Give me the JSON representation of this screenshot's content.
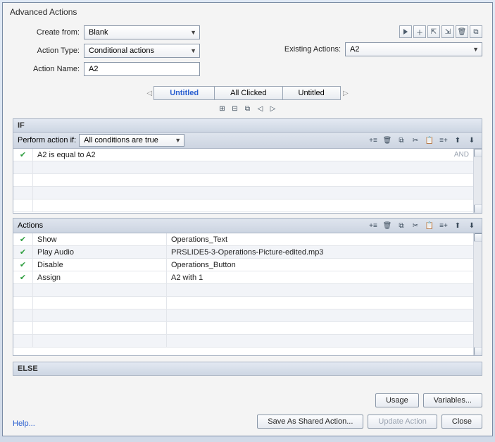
{
  "title": "Advanced Actions",
  "form": {
    "createFromLabel": "Create from:",
    "createFromValue": "Blank",
    "actionTypeLabel": "Action Type:",
    "actionTypeValue": "Conditional actions",
    "actionNameLabel": "Action Name:",
    "actionNameValue": "A2",
    "existingActionsLabel": "Existing Actions:",
    "existingActionsValue": "A2"
  },
  "tabs": [
    "Untitled",
    "All Clicked",
    "Untitled"
  ],
  "ifSection": {
    "header": "IF",
    "performLabel": "Perform action if:",
    "performValue": "All conditions are true",
    "rows": [
      {
        "text": "A2   is equal to   A2",
        "and": "AND"
      }
    ]
  },
  "actionsSection": {
    "header": "Actions",
    "rows": [
      {
        "action": "Show",
        "target": "Operations_Text"
      },
      {
        "action": "Play Audio",
        "target": "PRSLIDE5-3-Operations-Picture-edited.mp3"
      },
      {
        "action": "Disable",
        "target": "Operations_Button"
      },
      {
        "action": "Assign",
        "target": "A2   with   1"
      }
    ]
  },
  "elseSection": {
    "header": "ELSE"
  },
  "buttons": {
    "usage": "Usage",
    "variables": "Variables...",
    "saveShared": "Save As Shared Action...",
    "update": "Update Action",
    "close": "Close",
    "help": "Help..."
  }
}
